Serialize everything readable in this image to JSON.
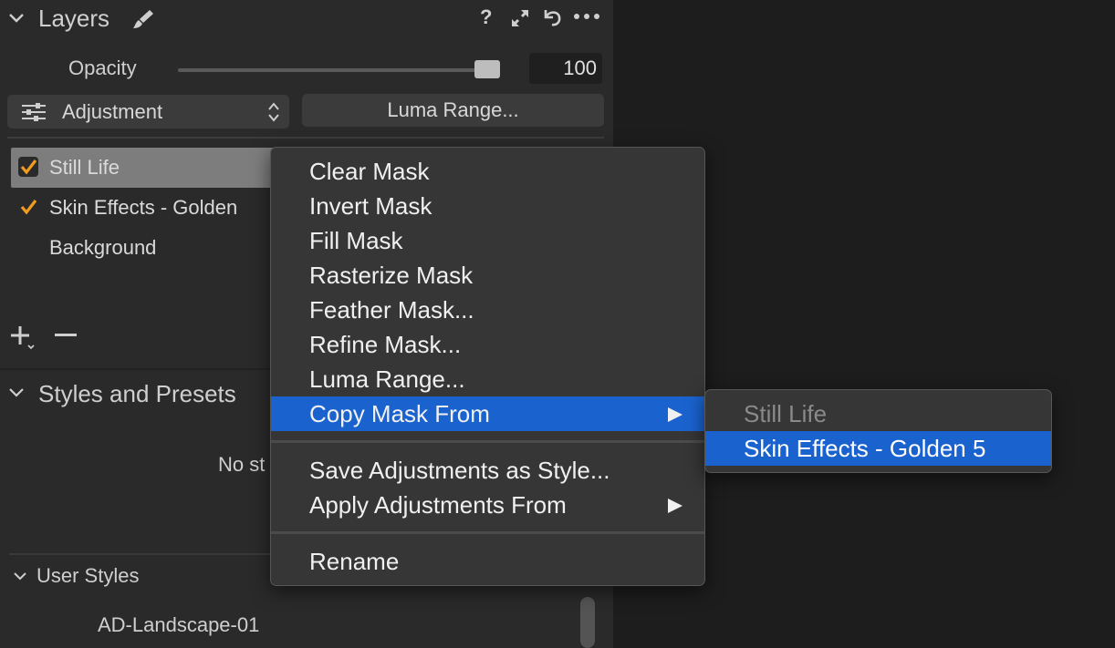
{
  "layers_panel": {
    "title": "Layers",
    "header_icons": [
      "question-icon",
      "expand-icon",
      "reset-icon",
      "more-icon"
    ],
    "help_glyph": "?",
    "opacity_label": "Opacity",
    "opacity_value": "100",
    "opacity_fraction": 1.0,
    "adjustment_select": "Adjustment",
    "luma_button": "Luma Range...",
    "layers": [
      {
        "name": "Still Life",
        "checked": true,
        "selected": true
      },
      {
        "name": "Skin Effects - Golden",
        "checked": true,
        "selected": false
      },
      {
        "name": "Background",
        "checked": false,
        "selected": false
      }
    ]
  },
  "styles_panel": {
    "title": "Styles and Presets",
    "empty_text": "No st",
    "user_styles_label": "User Styles",
    "user_styles_items": [
      "AD-Landscape-01"
    ]
  },
  "context_menu": {
    "items": [
      {
        "label": "Clear Mask"
      },
      {
        "label": "Invert Mask"
      },
      {
        "label": "Fill Mask"
      },
      {
        "label": "Rasterize Mask"
      },
      {
        "label": "Feather Mask..."
      },
      {
        "label": "Refine Mask..."
      },
      {
        "label": "Luma Range..."
      },
      {
        "label": "Copy Mask From",
        "submenu": true,
        "highlighted": true
      },
      {
        "label": "Save Adjustments as Style..."
      },
      {
        "label": "Apply Adjustments From",
        "submenu": true
      },
      {
        "label": "Rename"
      }
    ],
    "submenu_items": [
      {
        "label": "Still Life",
        "disabled": true
      },
      {
        "label": "Skin Effects - Golden 5",
        "highlighted": true
      }
    ]
  },
  "colors": {
    "accent_blue": "#1a63cf",
    "checkbox_orange": "#f29c1f",
    "panel_bg": "#2a2a2a"
  }
}
